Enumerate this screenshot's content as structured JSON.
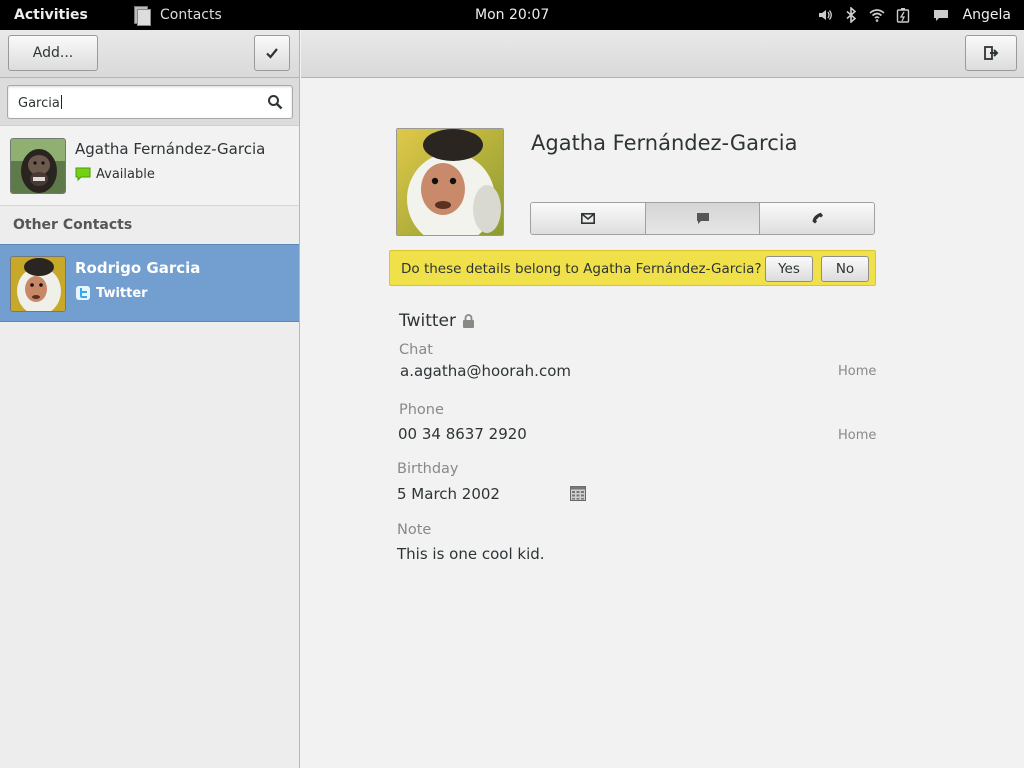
{
  "topbar": {
    "activities": "Activities",
    "app_name": "Contacts",
    "clock": "Mon 20:07",
    "user": "Angela",
    "tray_icons": [
      "volume-icon",
      "bluetooth-icon",
      "wifi-icon",
      "battery-icon",
      "chat-icon"
    ]
  },
  "left": {
    "add_label": "Add...",
    "search_value": "Garcia",
    "contacts": [
      {
        "name": "Agatha Fernández-Garcia",
        "status": "Available",
        "status_icon": "chat-available-icon"
      }
    ],
    "other_header": "Other Contacts",
    "other_contacts": [
      {
        "name": "Rodrigo Garcia",
        "status": "Twitter",
        "status_icon": "twitter-icon",
        "selected": true
      }
    ]
  },
  "detail": {
    "name": "Agatha Fernández-Garcia",
    "link_question": "Do these details belong to Agatha Fernández-Garcia?",
    "yes_label": "Yes",
    "no_label": "No",
    "section_title": "Twitter",
    "fields": {
      "chat": {
        "label": "Chat",
        "value": "a.agatha@hoorah.com",
        "type": "Home"
      },
      "phone": {
        "label": "Phone",
        "value": "00 34 8637 2920",
        "type": "Home"
      },
      "birthday": {
        "label": "Birthday",
        "value": "5 March 2002"
      },
      "note": {
        "label": "Note",
        "value": "This is one cool kid."
      }
    }
  },
  "colors": {
    "selection": "#729fcf",
    "infobar": "#f0e14b",
    "topbar": "#000000"
  }
}
